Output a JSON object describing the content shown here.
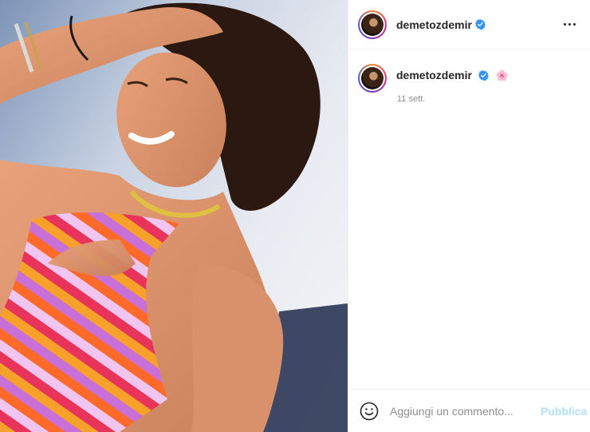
{
  "post": {
    "image_description_icon": "photo",
    "colors": {
      "verified": "#3897f0",
      "publish_disabled": "#b2dffc",
      "muted": "#8e8e8e"
    }
  },
  "header": {
    "username": "demetozdemir",
    "verified_icon": "verified-badge-icon",
    "more_icon": "more-options-icon"
  },
  "caption": {
    "username": "demetozdemir",
    "emoji": "🌸",
    "timestamp": "11 sett."
  },
  "comment_box": {
    "emoji_icon": "smiley-icon",
    "placeholder": "Aggiungi un commento...",
    "publish_label": "Pubblica"
  }
}
